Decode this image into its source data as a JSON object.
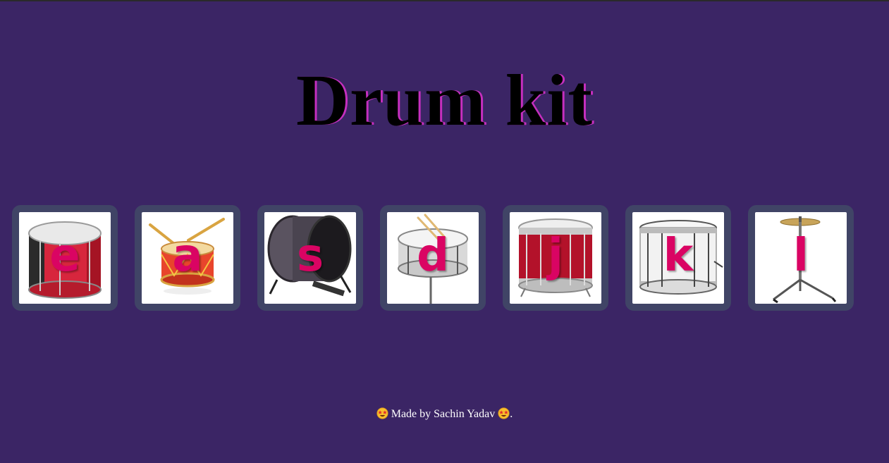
{
  "page": {
    "title": "Drum kit",
    "background": "#3b2565",
    "title_shadow_color": "#c52fbf"
  },
  "drums": [
    {
      "key": "e",
      "icon": "tom-drum-red-icon"
    },
    {
      "key": "a",
      "icon": "toy-drum-sticks-icon"
    },
    {
      "key": "s",
      "icon": "bass-drum-icon"
    },
    {
      "key": "d",
      "icon": "snare-drum-sticks-icon"
    },
    {
      "key": "j",
      "icon": "marching-snare-red-icon"
    },
    {
      "key": "k",
      "icon": "marching-snare-white-icon"
    },
    {
      "key": "l",
      "icon": "cymbal-stand-icon"
    }
  ],
  "footer": {
    "prefix_icon": "star-struck-emoji-icon",
    "text": "Made by Sachin Yadav",
    "suffix_icon": "star-struck-emoji-icon",
    "trailing": "."
  },
  "colors": {
    "pad_border": "#404466",
    "letter": "#da0463"
  }
}
